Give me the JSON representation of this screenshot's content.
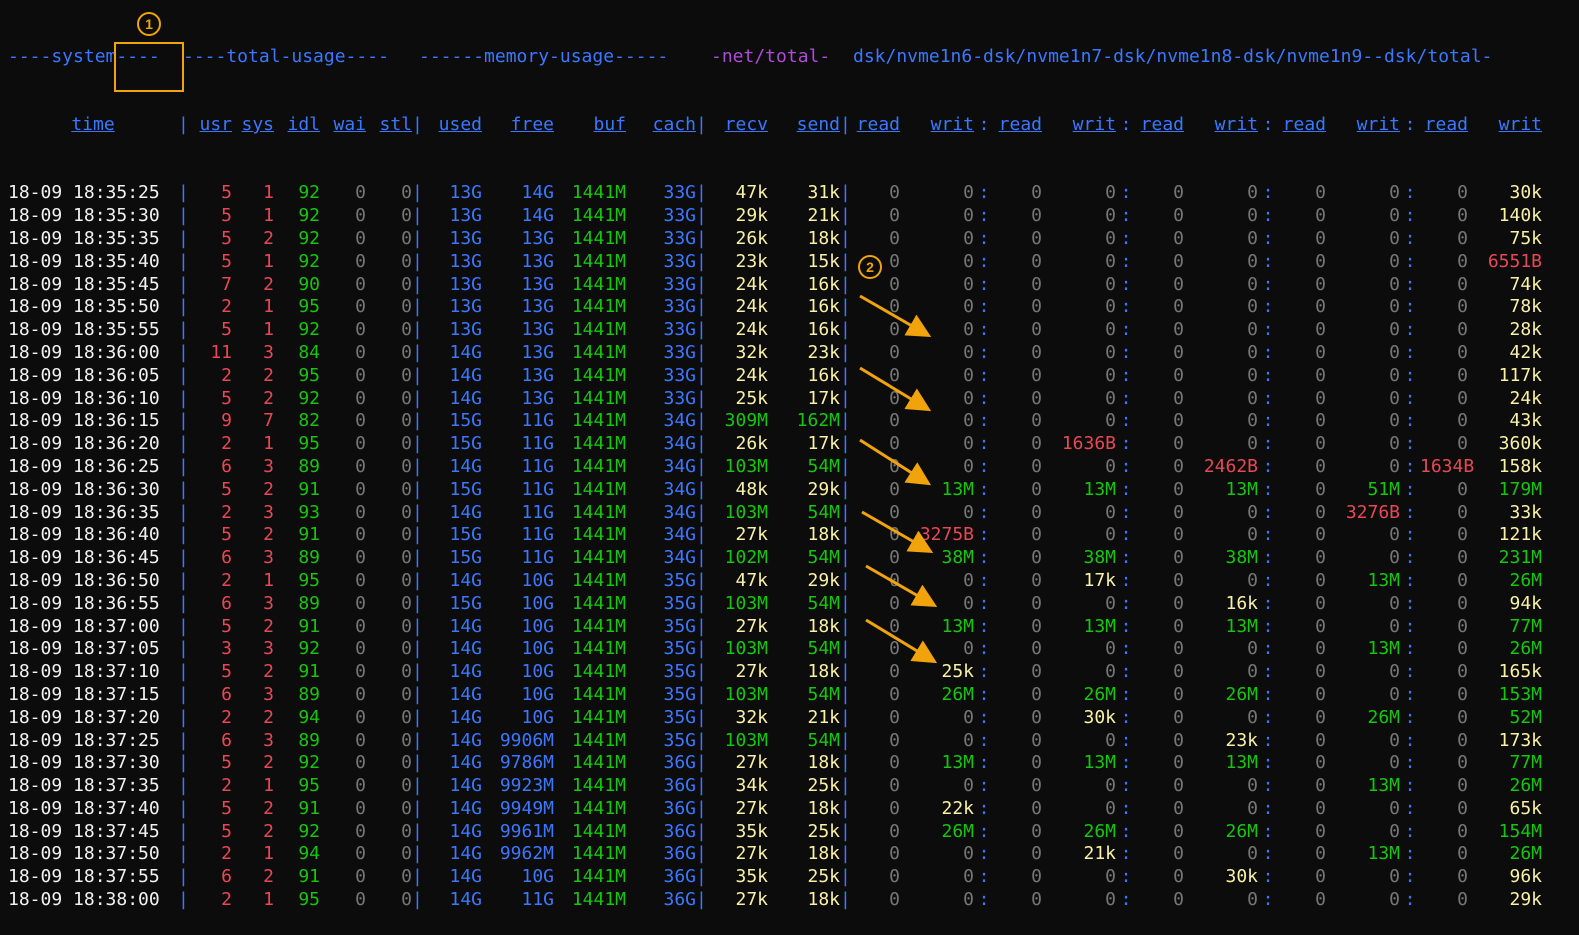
{
  "header1": {
    "system": "----system----",
    "total_usage": "----total-usage----",
    "memory_usage": "------memory-usage-----",
    "net_total": "-net/total-",
    "dsk": "dsk/nvme1n6-dsk/nvme1n7-dsk/nvme1n8-dsk/nvme1n9--dsk/total-"
  },
  "header2": {
    "time": "time",
    "usr": "usr",
    "sys": "sys",
    "idl": "idl",
    "wai": "wai",
    "stl": "stl",
    "used": "used",
    "free": "free",
    "buf": "buf",
    "cach": "cach",
    "recv": "recv",
    "send": "send",
    "read": "read",
    "writ": "writ"
  },
  "rows": [
    {
      "t": "18-09 18:35:25",
      "usr": "5",
      "sys": "1",
      "idl": "92",
      "wai": "0",
      "stl": "0",
      "used": "13G",
      "free": "14G",
      "buf": "1441M",
      "cach": "33G",
      "recv": "47k",
      "send": "31k",
      "d": [
        "0",
        "0",
        "0",
        "0",
        "0",
        "0",
        "0",
        "0",
        "0",
        "30k"
      ]
    },
    {
      "t": "18-09 18:35:30",
      "usr": "5",
      "sys": "1",
      "idl": "92",
      "wai": "0",
      "stl": "0",
      "used": "13G",
      "free": "14G",
      "buf": "1441M",
      "cach": "33G",
      "recv": "29k",
      "send": "21k",
      "d": [
        "0",
        "0",
        "0",
        "0",
        "0",
        "0",
        "0",
        "0",
        "0",
        "140k"
      ]
    },
    {
      "t": "18-09 18:35:35",
      "usr": "5",
      "sys": "2",
      "idl": "92",
      "wai": "0",
      "stl": "0",
      "used": "13G",
      "free": "13G",
      "buf": "1441M",
      "cach": "33G",
      "recv": "26k",
      "send": "18k",
      "d": [
        "0",
        "0",
        "0",
        "0",
        "0",
        "0",
        "0",
        "0",
        "0",
        "75k"
      ]
    },
    {
      "t": "18-09 18:35:40",
      "usr": "5",
      "sys": "1",
      "idl": "92",
      "wai": "0",
      "stl": "0",
      "used": "13G",
      "free": "13G",
      "buf": "1441M",
      "cach": "33G",
      "recv": "23k",
      "send": "15k",
      "d": [
        "0",
        "0",
        "0",
        "0",
        "0",
        "0",
        "0",
        "0",
        "0",
        "6551B"
      ]
    },
    {
      "t": "18-09 18:35:45",
      "usr": "7",
      "sys": "2",
      "idl": "90",
      "wai": "0",
      "stl": "0",
      "used": "13G",
      "free": "13G",
      "buf": "1441M",
      "cach": "33G",
      "recv": "24k",
      "send": "16k",
      "d": [
        "0",
        "0",
        "0",
        "0",
        "0",
        "0",
        "0",
        "0",
        "0",
        "74k"
      ]
    },
    {
      "t": "18-09 18:35:50",
      "usr": "2",
      "sys": "1",
      "idl": "95",
      "wai": "0",
      "stl": "0",
      "used": "13G",
      "free": "13G",
      "buf": "1441M",
      "cach": "33G",
      "recv": "24k",
      "send": "16k",
      "d": [
        "0",
        "0",
        "0",
        "0",
        "0",
        "0",
        "0",
        "0",
        "0",
        "78k"
      ]
    },
    {
      "t": "18-09 18:35:55",
      "usr": "5",
      "sys": "1",
      "idl": "92",
      "wai": "0",
      "stl": "0",
      "used": "13G",
      "free": "13G",
      "buf": "1441M",
      "cach": "33G",
      "recv": "24k",
      "send": "16k",
      "d": [
        "0",
        "0",
        "0",
        "0",
        "0",
        "0",
        "0",
        "0",
        "0",
        "28k"
      ]
    },
    {
      "t": "18-09 18:36:00",
      "usr": "11",
      "sys": "3",
      "idl": "84",
      "wai": "0",
      "stl": "0",
      "used": "14G",
      "free": "13G",
      "buf": "1441M",
      "cach": "33G",
      "recv": "32k",
      "send": "23k",
      "d": [
        "0",
        "0",
        "0",
        "0",
        "0",
        "0",
        "0",
        "0",
        "0",
        "42k"
      ]
    },
    {
      "t": "18-09 18:36:05",
      "usr": "2",
      "sys": "2",
      "idl": "95",
      "wai": "0",
      "stl": "0",
      "used": "14G",
      "free": "13G",
      "buf": "1441M",
      "cach": "33G",
      "recv": "24k",
      "send": "16k",
      "d": [
        "0",
        "0",
        "0",
        "0",
        "0",
        "0",
        "0",
        "0",
        "0",
        "117k"
      ]
    },
    {
      "t": "18-09 18:36:10",
      "usr": "5",
      "sys": "2",
      "idl": "92",
      "wai": "0",
      "stl": "0",
      "used": "14G",
      "free": "13G",
      "buf": "1441M",
      "cach": "33G",
      "recv": "25k",
      "send": "17k",
      "d": [
        "0",
        "0",
        "0",
        "0",
        "0",
        "0",
        "0",
        "0",
        "0",
        "24k"
      ]
    },
    {
      "t": "18-09 18:36:15",
      "usr": "9",
      "sys": "7",
      "idl": "82",
      "wai": "0",
      "stl": "0",
      "used": "15G",
      "free": "11G",
      "buf": "1441M",
      "cach": "34G",
      "recv": "309M",
      "send": "162M",
      "d": [
        "0",
        "0",
        "0",
        "0",
        "0",
        "0",
        "0",
        "0",
        "0",
        "43k"
      ]
    },
    {
      "t": "18-09 18:36:20",
      "usr": "2",
      "sys": "1",
      "idl": "95",
      "wai": "0",
      "stl": "0",
      "used": "15G",
      "free": "11G",
      "buf": "1441M",
      "cach": "34G",
      "recv": "26k",
      "send": "17k",
      "d": [
        "0",
        "0",
        "0",
        "1636B",
        "0",
        "0",
        "0",
        "0",
        "0",
        "360k"
      ]
    },
    {
      "t": "18-09 18:36:25",
      "usr": "6",
      "sys": "3",
      "idl": "89",
      "wai": "0",
      "stl": "0",
      "used": "14G",
      "free": "11G",
      "buf": "1441M",
      "cach": "34G",
      "recv": "103M",
      "send": "54M",
      "d": [
        "0",
        "0",
        "0",
        "0",
        "0",
        "2462B",
        "0",
        "0",
        "1634B",
        "158k"
      ]
    },
    {
      "t": "18-09 18:36:30",
      "usr": "5",
      "sys": "2",
      "idl": "91",
      "wai": "0",
      "stl": "0",
      "used": "15G",
      "free": "11G",
      "buf": "1441M",
      "cach": "34G",
      "recv": "48k",
      "send": "29k",
      "d": [
        "0",
        "13M",
        "0",
        "13M",
        "0",
        "13M",
        "0",
        "51M",
        "0",
        "179M"
      ]
    },
    {
      "t": "18-09 18:36:35",
      "usr": "2",
      "sys": "3",
      "idl": "93",
      "wai": "0",
      "stl": "0",
      "used": "14G",
      "free": "11G",
      "buf": "1441M",
      "cach": "34G",
      "recv": "103M",
      "send": "54M",
      "d": [
        "0",
        "0",
        "0",
        "0",
        "0",
        "0",
        "0",
        "3276B",
        "0",
        "33k"
      ]
    },
    {
      "t": "18-09 18:36:40",
      "usr": "5",
      "sys": "2",
      "idl": "91",
      "wai": "0",
      "stl": "0",
      "used": "15G",
      "free": "11G",
      "buf": "1441M",
      "cach": "34G",
      "recv": "27k",
      "send": "18k",
      "d": [
        "0",
        "3275B",
        "0",
        "0",
        "0",
        "0",
        "0",
        "0",
        "0",
        "121k"
      ]
    },
    {
      "t": "18-09 18:36:45",
      "usr": "6",
      "sys": "3",
      "idl": "89",
      "wai": "0",
      "stl": "0",
      "used": "15G",
      "free": "11G",
      "buf": "1441M",
      "cach": "34G",
      "recv": "102M",
      "send": "54M",
      "d": [
        "0",
        "38M",
        "0",
        "38M",
        "0",
        "38M",
        "0",
        "0",
        "0",
        "231M"
      ]
    },
    {
      "t": "18-09 18:36:50",
      "usr": "2",
      "sys": "1",
      "idl": "95",
      "wai": "0",
      "stl": "0",
      "used": "14G",
      "free": "10G",
      "buf": "1441M",
      "cach": "35G",
      "recv": "47k",
      "send": "29k",
      "d": [
        "0",
        "0",
        "0",
        "17k",
        "0",
        "0",
        "0",
        "13M",
        "0",
        "26M"
      ]
    },
    {
      "t": "18-09 18:36:55",
      "usr": "6",
      "sys": "3",
      "idl": "89",
      "wai": "0",
      "stl": "0",
      "used": "15G",
      "free": "10G",
      "buf": "1441M",
      "cach": "35G",
      "recv": "103M",
      "send": "54M",
      "d": [
        "0",
        "0",
        "0",
        "0",
        "0",
        "16k",
        "0",
        "0",
        "0",
        "94k"
      ]
    },
    {
      "t": "18-09 18:37:00",
      "usr": "5",
      "sys": "2",
      "idl": "91",
      "wai": "0",
      "stl": "0",
      "used": "14G",
      "free": "10G",
      "buf": "1441M",
      "cach": "35G",
      "recv": "27k",
      "send": "18k",
      "d": [
        "0",
        "13M",
        "0",
        "13M",
        "0",
        "13M",
        "0",
        "0",
        "0",
        "77M"
      ]
    },
    {
      "t": "18-09 18:37:05",
      "usr": "3",
      "sys": "3",
      "idl": "92",
      "wai": "0",
      "stl": "0",
      "used": "14G",
      "free": "10G",
      "buf": "1441M",
      "cach": "35G",
      "recv": "103M",
      "send": "54M",
      "d": [
        "0",
        "0",
        "0",
        "0",
        "0",
        "0",
        "0",
        "13M",
        "0",
        "26M"
      ]
    },
    {
      "t": "18-09 18:37:10",
      "usr": "5",
      "sys": "2",
      "idl": "91",
      "wai": "0",
      "stl": "0",
      "used": "14G",
      "free": "10G",
      "buf": "1441M",
      "cach": "35G",
      "recv": "27k",
      "send": "18k",
      "d": [
        "0",
        "25k",
        "0",
        "0",
        "0",
        "0",
        "0",
        "0",
        "0",
        "165k"
      ]
    },
    {
      "t": "18-09 18:37:15",
      "usr": "6",
      "sys": "3",
      "idl": "89",
      "wai": "0",
      "stl": "0",
      "used": "14G",
      "free": "10G",
      "buf": "1441M",
      "cach": "35G",
      "recv": "103M",
      "send": "54M",
      "d": [
        "0",
        "26M",
        "0",
        "26M",
        "0",
        "26M",
        "0",
        "0",
        "0",
        "153M"
      ]
    },
    {
      "t": "18-09 18:37:20",
      "usr": "2",
      "sys": "2",
      "idl": "94",
      "wai": "0",
      "stl": "0",
      "used": "14G",
      "free": "10G",
      "buf": "1441M",
      "cach": "35G",
      "recv": "32k",
      "send": "21k",
      "d": [
        "0",
        "0",
        "0",
        "30k",
        "0",
        "0",
        "0",
        "26M",
        "0",
        "52M"
      ]
    },
    {
      "t": "18-09 18:37:25",
      "usr": "6",
      "sys": "3",
      "idl": "89",
      "wai": "0",
      "stl": "0",
      "used": "14G",
      "free": "9906M",
      "buf": "1441M",
      "cach": "35G",
      "recv": "103M",
      "send": "54M",
      "d": [
        "0",
        "0",
        "0",
        "0",
        "0",
        "23k",
        "0",
        "0",
        "0",
        "173k"
      ]
    },
    {
      "t": "18-09 18:37:30",
      "usr": "5",
      "sys": "2",
      "idl": "92",
      "wai": "0",
      "stl": "0",
      "used": "14G",
      "free": "9786M",
      "buf": "1441M",
      "cach": "36G",
      "recv": "27k",
      "send": "18k",
      "d": [
        "0",
        "13M",
        "0",
        "13M",
        "0",
        "13M",
        "0",
        "0",
        "0",
        "77M"
      ]
    },
    {
      "t": "18-09 18:37:35",
      "usr": "2",
      "sys": "1",
      "idl": "95",
      "wai": "0",
      "stl": "0",
      "used": "14G",
      "free": "9923M",
      "buf": "1441M",
      "cach": "36G",
      "recv": "34k",
      "send": "25k",
      "d": [
        "0",
        "0",
        "0",
        "0",
        "0",
        "0",
        "0",
        "13M",
        "0",
        "26M"
      ]
    },
    {
      "t": "18-09 18:37:40",
      "usr": "5",
      "sys": "2",
      "idl": "91",
      "wai": "0",
      "stl": "0",
      "used": "14G",
      "free": "9949M",
      "buf": "1441M",
      "cach": "36G",
      "recv": "27k",
      "send": "18k",
      "d": [
        "0",
        "22k",
        "0",
        "0",
        "0",
        "0",
        "0",
        "0",
        "0",
        "65k"
      ]
    },
    {
      "t": "18-09 18:37:45",
      "usr": "5",
      "sys": "2",
      "idl": "92",
      "wai": "0",
      "stl": "0",
      "used": "14G",
      "free": "9961M",
      "buf": "1441M",
      "cach": "36G",
      "recv": "35k",
      "send": "25k",
      "d": [
        "0",
        "26M",
        "0",
        "26M",
        "0",
        "26M",
        "0",
        "0",
        "0",
        "154M"
      ]
    },
    {
      "t": "18-09 18:37:50",
      "usr": "2",
      "sys": "1",
      "idl": "94",
      "wai": "0",
      "stl": "0",
      "used": "14G",
      "free": "9962M",
      "buf": "1441M",
      "cach": "36G",
      "recv": "27k",
      "send": "18k",
      "d": [
        "0",
        "0",
        "0",
        "21k",
        "0",
        "0",
        "0",
        "13M",
        "0",
        "26M"
      ]
    },
    {
      "t": "18-09 18:37:55",
      "usr": "6",
      "sys": "2",
      "idl": "91",
      "wai": "0",
      "stl": "0",
      "used": "14G",
      "free": "10G",
      "buf": "1441M",
      "cach": "36G",
      "recv": "35k",
      "send": "25k",
      "d": [
        "0",
        "0",
        "0",
        "0",
        "0",
        "30k",
        "0",
        "0",
        "0",
        "96k"
      ]
    },
    {
      "t": "18-09 18:38:00",
      "usr": "2",
      "sys": "1",
      "idl": "95",
      "wai": "0",
      "stl": "0",
      "used": "14G",
      "free": "11G",
      "buf": "1441M",
      "cach": "36G",
      "recv": "27k",
      "send": "18k",
      "d": [
        "0",
        "0",
        "0",
        "0",
        "0",
        "0",
        "0",
        "0",
        "0",
        "29k"
      ]
    }
  ],
  "annotations": {
    "badge1": "1",
    "badge2": "2"
  },
  "colors": {
    "accent_annotation": "#f0a30a",
    "header_blue": "#3b78ff",
    "header_purple": "#b04bd6",
    "value_red": "#e74856",
    "value_green": "#16c60c",
    "value_yellow": "#f9f1a5",
    "zero_gray": "#767676"
  }
}
